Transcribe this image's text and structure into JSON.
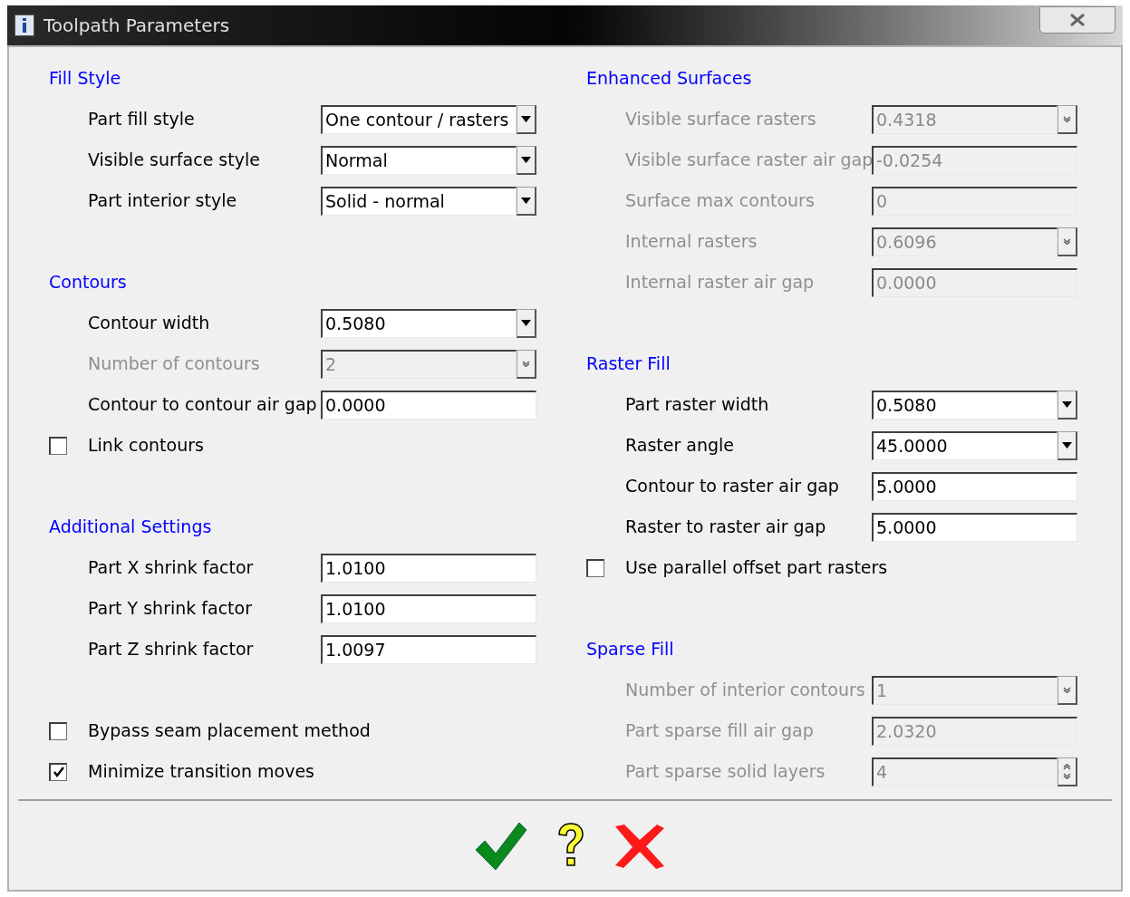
{
  "window": {
    "title": "Toolpath Parameters"
  },
  "left_column": {
    "sections": [
      {
        "heading": "Fill Style",
        "rows": [
          {
            "kind": "dropdown",
            "label": "Part fill style",
            "value": "One contour / rasters",
            "disabled": false
          },
          {
            "kind": "dropdown",
            "label": "Visible surface style",
            "value": "Normal",
            "disabled": false
          },
          {
            "kind": "dropdown",
            "label": "Part interior style",
            "value": "Solid - normal",
            "disabled": false
          }
        ]
      },
      {
        "heading": "Contours",
        "rows": [
          {
            "kind": "dropdown",
            "label": "Contour width",
            "value": "0.5080",
            "disabled": false
          },
          {
            "kind": "dropdown",
            "label": "Number of contours",
            "value": "2",
            "disabled": true
          },
          {
            "kind": "text",
            "label": "Contour to contour air gap",
            "value": "0.0000",
            "disabled": false
          },
          {
            "kind": "checkbox",
            "label": "Link contours",
            "checked": false
          }
        ]
      },
      {
        "heading": "Additional Settings",
        "rows": [
          {
            "kind": "text",
            "label": "Part X shrink factor",
            "value": "1.0100",
            "disabled": false
          },
          {
            "kind": "text",
            "label": "Part Y shrink factor",
            "value": "1.0100",
            "disabled": false
          },
          {
            "kind": "text",
            "label": "Part Z shrink factor",
            "value": "1.0097",
            "disabled": false
          }
        ]
      }
    ],
    "options": [
      {
        "kind": "checkbox",
        "label": "Bypass seam placement method",
        "checked": false
      },
      {
        "kind": "checkbox",
        "label": "Minimize transition moves",
        "checked": true
      }
    ]
  },
  "right_column": {
    "sections": [
      {
        "heading": "Enhanced Surfaces",
        "rows": [
          {
            "kind": "dropdown",
            "label": "Visible surface rasters",
            "value": "0.4318",
            "disabled": true
          },
          {
            "kind": "text",
            "label": "Visible surface raster air gap",
            "value": "-0.0254",
            "disabled": true
          },
          {
            "kind": "text",
            "label": "Surface max contours",
            "value": "0",
            "disabled": true
          },
          {
            "kind": "dropdown",
            "label": "Internal rasters",
            "value": "0.6096",
            "disabled": true
          },
          {
            "kind": "text",
            "label": "Internal raster air gap",
            "value": "0.0000",
            "disabled": true
          }
        ]
      },
      {
        "heading": "Raster Fill",
        "rows": [
          {
            "kind": "dropdown",
            "label": "Part raster width",
            "value": "0.5080",
            "disabled": false
          },
          {
            "kind": "dropdown",
            "label": "Raster angle",
            "value": "45.0000",
            "disabled": false
          },
          {
            "kind": "text",
            "label": "Contour to raster air gap",
            "value": "5.0000",
            "disabled": false
          },
          {
            "kind": "text",
            "label": "Raster to raster air gap",
            "value": "5.0000",
            "disabled": false
          },
          {
            "kind": "checkbox",
            "label": "Use parallel offset part rasters",
            "checked": false
          }
        ]
      },
      {
        "heading": "Sparse Fill",
        "rows": [
          {
            "kind": "dropdown",
            "label": "Number of interior contours",
            "value": "1",
            "disabled": true
          },
          {
            "kind": "text",
            "label": "Part sparse fill air gap",
            "value": "2.0320",
            "disabled": true
          },
          {
            "kind": "spinner",
            "label": "Part sparse solid layers",
            "value": "4",
            "disabled": true
          }
        ]
      }
    ]
  },
  "footer_buttons": [
    {
      "kind": "ok"
    },
    {
      "kind": "help"
    },
    {
      "kind": "cancel"
    }
  ]
}
